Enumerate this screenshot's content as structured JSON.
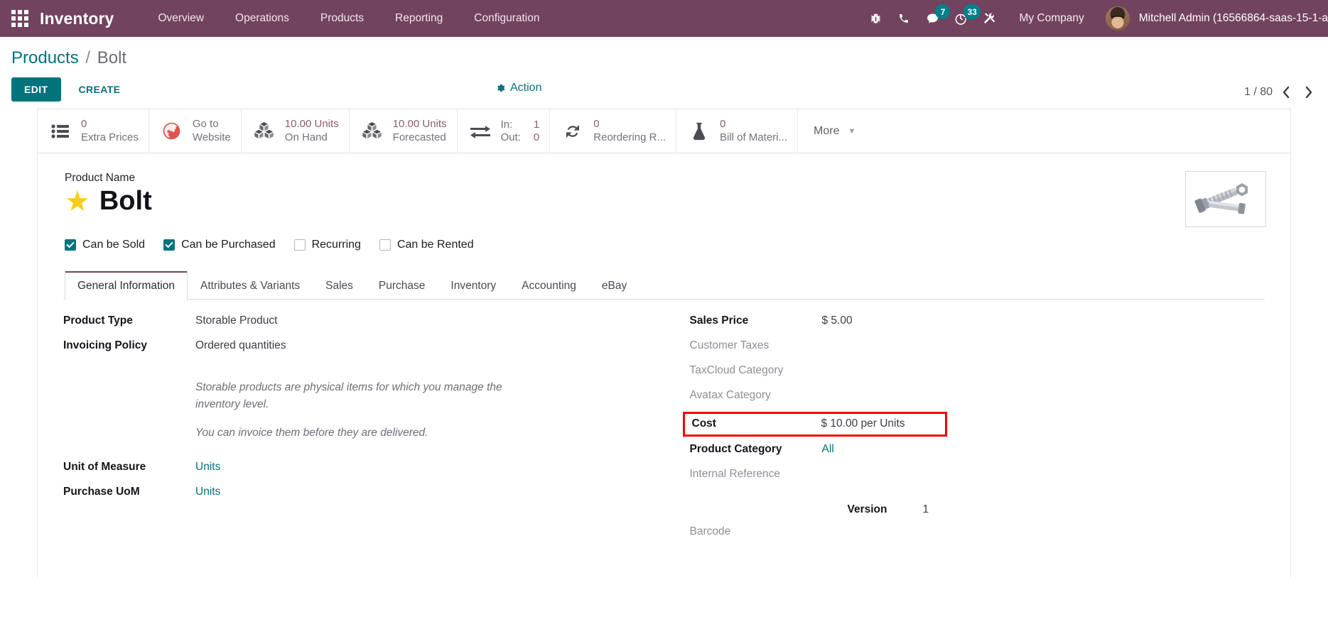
{
  "navbar": {
    "apps_icon": "apps-grid-icon",
    "brand": "Inventory",
    "menu": [
      {
        "label": "Overview"
      },
      {
        "label": "Operations"
      },
      {
        "label": "Products"
      },
      {
        "label": "Reporting"
      },
      {
        "label": "Configuration"
      }
    ],
    "system_icons": [
      {
        "name": "bug-icon",
        "badge": ""
      },
      {
        "name": "phone-icon",
        "badge": ""
      },
      {
        "name": "messaging-icon",
        "badge": "7"
      },
      {
        "name": "activities-clock-icon",
        "badge": "33"
      },
      {
        "name": "tools-icon",
        "badge": ""
      }
    ],
    "company": "My Company",
    "user": "Mitchell Admin (16566864-saas-15-1-a",
    "bg_color": "#71435f"
  },
  "control_panel": {
    "breadcrumb": {
      "root": "Products",
      "separator": "/",
      "current": "Bolt"
    },
    "edit_label": "EDIT",
    "create_label": "CREATE",
    "action_label": "Action",
    "action_icon": "gear-icon",
    "pager": {
      "text": "1 / 80",
      "prev_icon": "chevron-left-icon",
      "next_icon": "chevron-right-icon"
    }
  },
  "stat_buttons": [
    {
      "icon": "list-pricelist-icon",
      "value": "0",
      "label": "Extra Prices",
      "layout": "two-line"
    },
    {
      "icon": "globe-website-icon",
      "value": "Go to",
      "label": "Website",
      "layout": "two-line"
    },
    {
      "icon": "cubes-icon",
      "value": "10.00 Units",
      "label": "On Hand",
      "layout": "two-line"
    },
    {
      "icon": "cubes-icon",
      "value": "10.00 Units",
      "label": "Forecasted",
      "layout": "two-line"
    },
    {
      "icon": "exchange-arrows-icon",
      "in_label": "In:",
      "in_value": "1",
      "out_label": "Out:",
      "out_value": "0",
      "layout": "in-out"
    },
    {
      "icon": "refresh-icon",
      "value": "0",
      "label": "Reordering R...",
      "layout": "two-line"
    },
    {
      "icon": "flask-icon",
      "value": "0",
      "label": "Bill of Materi...",
      "layout": "two-line"
    }
  ],
  "more_button": {
    "label": "More",
    "caret_icon": "caret-down-icon"
  },
  "product": {
    "name_caption": "Product Name",
    "name": "Bolt",
    "favorite_icon": "star-icon",
    "image_icon": "bolt-product-image"
  },
  "checkboxes": [
    {
      "label": "Can be Sold",
      "checked": true
    },
    {
      "label": "Can be Purchased",
      "checked": true
    },
    {
      "label": "Recurring",
      "checked": false
    },
    {
      "label": "Can be Rented",
      "checked": false
    }
  ],
  "tabs": [
    {
      "label": "General Information",
      "active": true
    },
    {
      "label": "Attributes & Variants",
      "active": false
    },
    {
      "label": "Sales",
      "active": false
    },
    {
      "label": "Purchase",
      "active": false
    },
    {
      "label": "Inventory",
      "active": false
    },
    {
      "label": "Accounting",
      "active": false
    },
    {
      "label": "eBay",
      "active": false
    }
  ],
  "form": {
    "left": {
      "product_type_label": "Product Type",
      "product_type_value": "Storable Product",
      "invoicing_policy_label": "Invoicing Policy",
      "invoicing_policy_value": "Ordered quantities",
      "help_line1": "Storable products are physical items for which you manage the inventory level.",
      "help_line2": "You can invoice them before they are delivered.",
      "uom_label": "Unit of Measure",
      "uom_value": "Units",
      "purchase_uom_label": "Purchase UoM",
      "purchase_uom_value": "Units"
    },
    "right": {
      "sales_price_label": "Sales Price",
      "sales_price_value": "$ 5.00",
      "customer_taxes_label": "Customer Taxes",
      "customer_taxes_value": "",
      "taxcloud_label": "TaxCloud Category",
      "taxcloud_value": "",
      "avatax_label": "Avatax Category",
      "avatax_value": "",
      "cost_label": "Cost",
      "cost_value": "$ 10.00",
      "cost_unit": "per Units",
      "product_category_label": "Product Category",
      "product_category_value": "All",
      "internal_ref_label": "Internal Reference",
      "internal_ref_value": "",
      "barcode_label": "Barcode",
      "barcode_value": "",
      "version_label": "Version",
      "version_value": "1"
    }
  },
  "colors": {
    "brand_purple": "#71435f",
    "accent_teal": "#00737c",
    "highlight_red": "#f50000",
    "stat_value": "#8f5c69",
    "star_yellow": "#f7cc1b"
  }
}
